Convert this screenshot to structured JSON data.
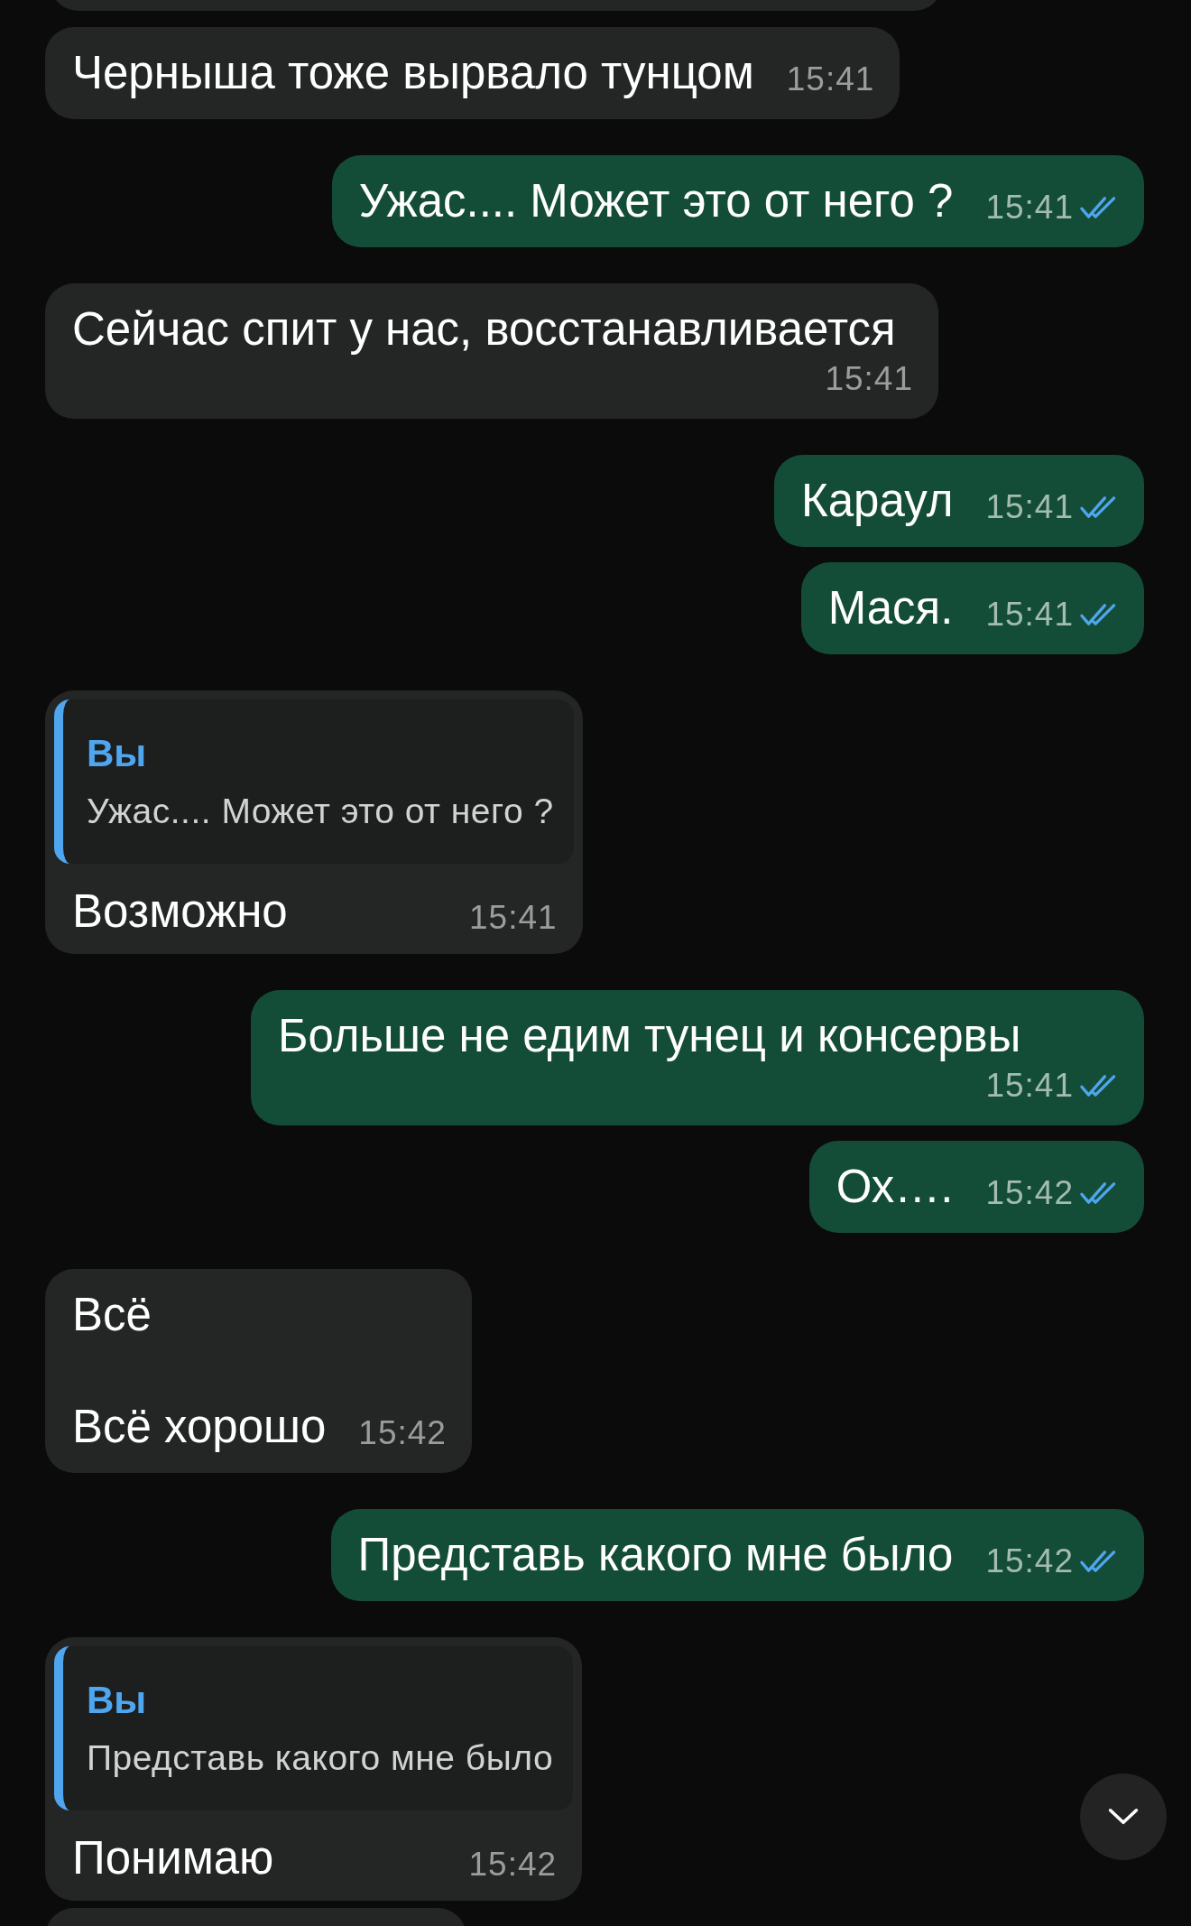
{
  "messages": [
    {
      "kind": "incoming",
      "text": "Черныша тоже вырвало тунцом",
      "time": "15:41"
    },
    {
      "kind": "outgoing",
      "text": "Ужас.... Может это от него ?",
      "time": "15:41",
      "read": true
    },
    {
      "kind": "incoming",
      "text": "Сейчас спит у нас, восстанавливается",
      "time": "15:41"
    },
    {
      "kind": "outgoing",
      "text": "Караул",
      "time": "15:41",
      "read": true
    },
    {
      "kind": "outgoing",
      "text": "Мася.",
      "time": "15:41",
      "read": true
    },
    {
      "kind": "incoming",
      "reply": {
        "author": "Вы",
        "text": "Ужас.... Может это от него ?"
      },
      "text": "Возможно",
      "time": "15:41"
    },
    {
      "kind": "outgoing",
      "text": "Больше не едим тунец и консервы",
      "time": "15:41",
      "read": true
    },
    {
      "kind": "outgoing",
      "text": "Ох….",
      "time": "15:42",
      "read": true
    },
    {
      "kind": "incoming",
      "text": "Всё\n\nВсё хорошо",
      "time": "15:42"
    },
    {
      "kind": "outgoing",
      "text": "Представь какого мне было",
      "time": "15:42",
      "read": true
    },
    {
      "kind": "incoming",
      "reply": {
        "author": "Вы",
        "text": "Представь какого мне было"
      },
      "text": "Понимаю",
      "time": "15:42"
    }
  ]
}
